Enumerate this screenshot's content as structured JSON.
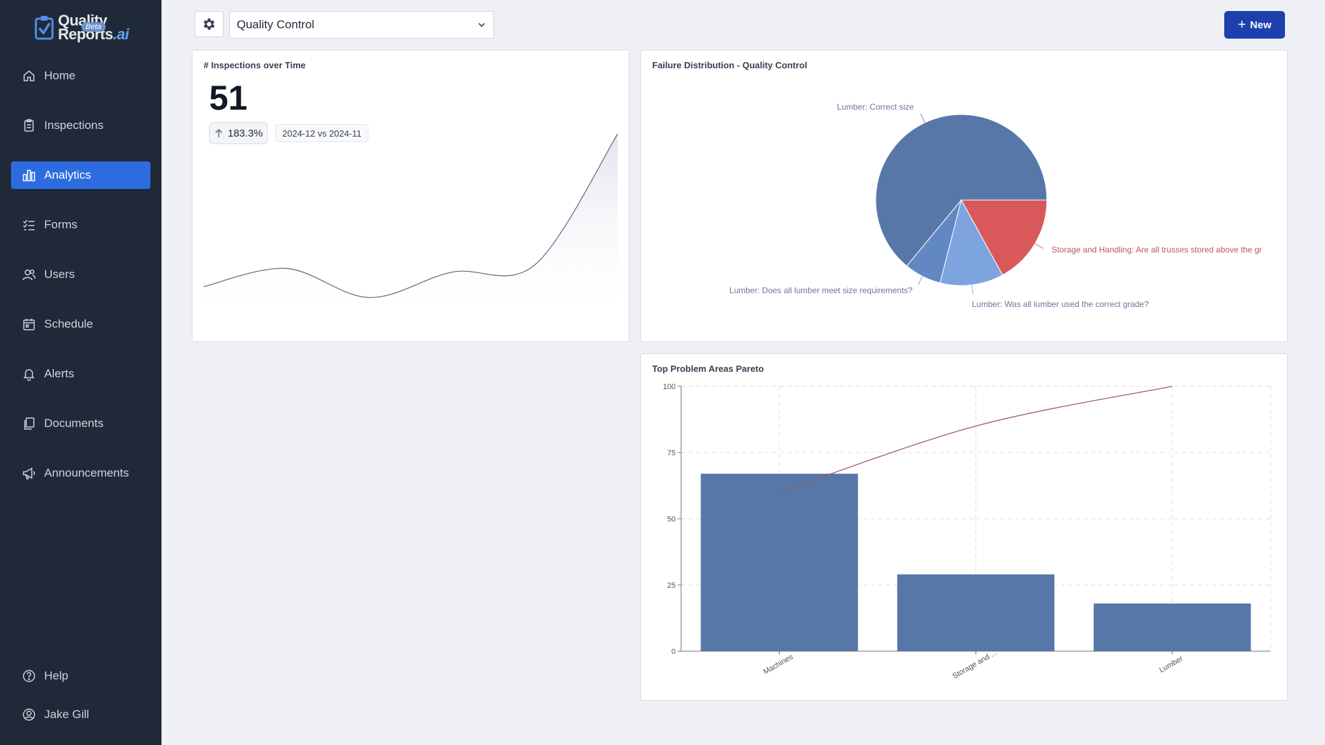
{
  "app": {
    "logo_line1": "Quality",
    "logo_line2": "Reports",
    "logo_suffix": ".ai",
    "beta": "Beta"
  },
  "sidebar": {
    "items": [
      {
        "label": "Home",
        "icon": "home-icon"
      },
      {
        "label": "Inspections",
        "icon": "clipboard-icon"
      },
      {
        "label": "Analytics",
        "icon": "bar-chart-icon",
        "active": true
      },
      {
        "label": "Forms",
        "icon": "checklist-icon"
      },
      {
        "label": "Users",
        "icon": "users-icon"
      },
      {
        "label": "Schedule",
        "icon": "calendar-icon"
      },
      {
        "label": "Alerts",
        "icon": "bell-icon"
      },
      {
        "label": "Documents",
        "icon": "documents-icon"
      },
      {
        "label": "Announcements",
        "icon": "megaphone-icon"
      }
    ],
    "bottom": [
      {
        "label": "Help",
        "icon": "help-icon"
      },
      {
        "label": "Jake Gill",
        "icon": "user-circle-icon"
      }
    ]
  },
  "toolbar": {
    "selected_form": "Quality Control",
    "new_label": "New"
  },
  "colors": {
    "sidebar_bg": "#1f2937",
    "accent": "#2d6cdf",
    "primary_button": "#1e40af",
    "series_blue": "#5677a8",
    "series_red": "#d9595a",
    "series_light": "#7ea4e0"
  },
  "inspections_card": {
    "title": "# Inspections over Time",
    "value": "51",
    "change": "183.3%",
    "period": "2024-12 vs 2024-11"
  },
  "chart_data": [
    {
      "type": "area",
      "title": "# Inspections over Time",
      "x": [
        1,
        2,
        3,
        4,
        5,
        6
      ],
      "values": [
        9,
        14,
        6,
        13,
        15,
        51
      ],
      "ylim": [
        0,
        55
      ],
      "grid": false
    },
    {
      "type": "pie",
      "title": "Failure Distribution - Quality Control",
      "labels": [
        "Lumber: Correct size",
        "Storage and Handling: Are all trusses stored above the gr",
        "Lumber: Was all lumber used the correct grade?",
        "Lumber: Does all lumber meet size requirements?"
      ],
      "values": [
        64,
        17,
        12,
        7
      ],
      "colors": [
        "#5677a8",
        "#d9595a",
        "#7ea4e0",
        "#6288c4"
      ]
    },
    {
      "type": "bar",
      "title": "Top Problem Areas Pareto",
      "categories": [
        "Machines",
        "Storage and ...",
        "Lumber"
      ],
      "values": [
        67,
        29,
        18
      ],
      "cumulative_line": [
        60,
        85,
        100
      ],
      "yticks": [
        0,
        25,
        50,
        75,
        100
      ],
      "ylim": [
        0,
        100
      ],
      "grid": true
    }
  ]
}
